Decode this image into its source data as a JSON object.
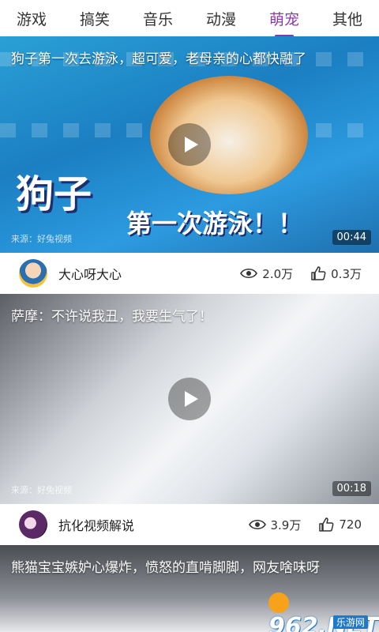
{
  "tabs": [
    {
      "label": "游戏"
    },
    {
      "label": "搞笑"
    },
    {
      "label": "音乐"
    },
    {
      "label": "动漫"
    },
    {
      "label": "萌宠",
      "active": true
    },
    {
      "label": "其他"
    }
  ],
  "accent_color": "#8a3ba3",
  "videos": [
    {
      "title": "狗子第一次去游泳，超可爱，老母亲的心都快融了",
      "overlay_big": "狗子",
      "overlay_small": "第一次游泳！！",
      "source": "来源：好兔视频",
      "duration": "00:44",
      "author": "大心呀大心",
      "views": "2.0万",
      "likes": "0.3万"
    },
    {
      "title": "萨摩：不许说我丑，我要生气了！",
      "source": "来源：好兔视频",
      "duration": "00:18",
      "author": "抗化视频解说",
      "views": "3.9万",
      "likes": "720"
    },
    {
      "title": "熊猫宝宝嫉妒心爆炸，愤怒的直啃脚脚，网友啥味呀"
    }
  ],
  "watermark": {
    "number": "962",
    "suffix": ".NET",
    "sub": "乐游网"
  }
}
